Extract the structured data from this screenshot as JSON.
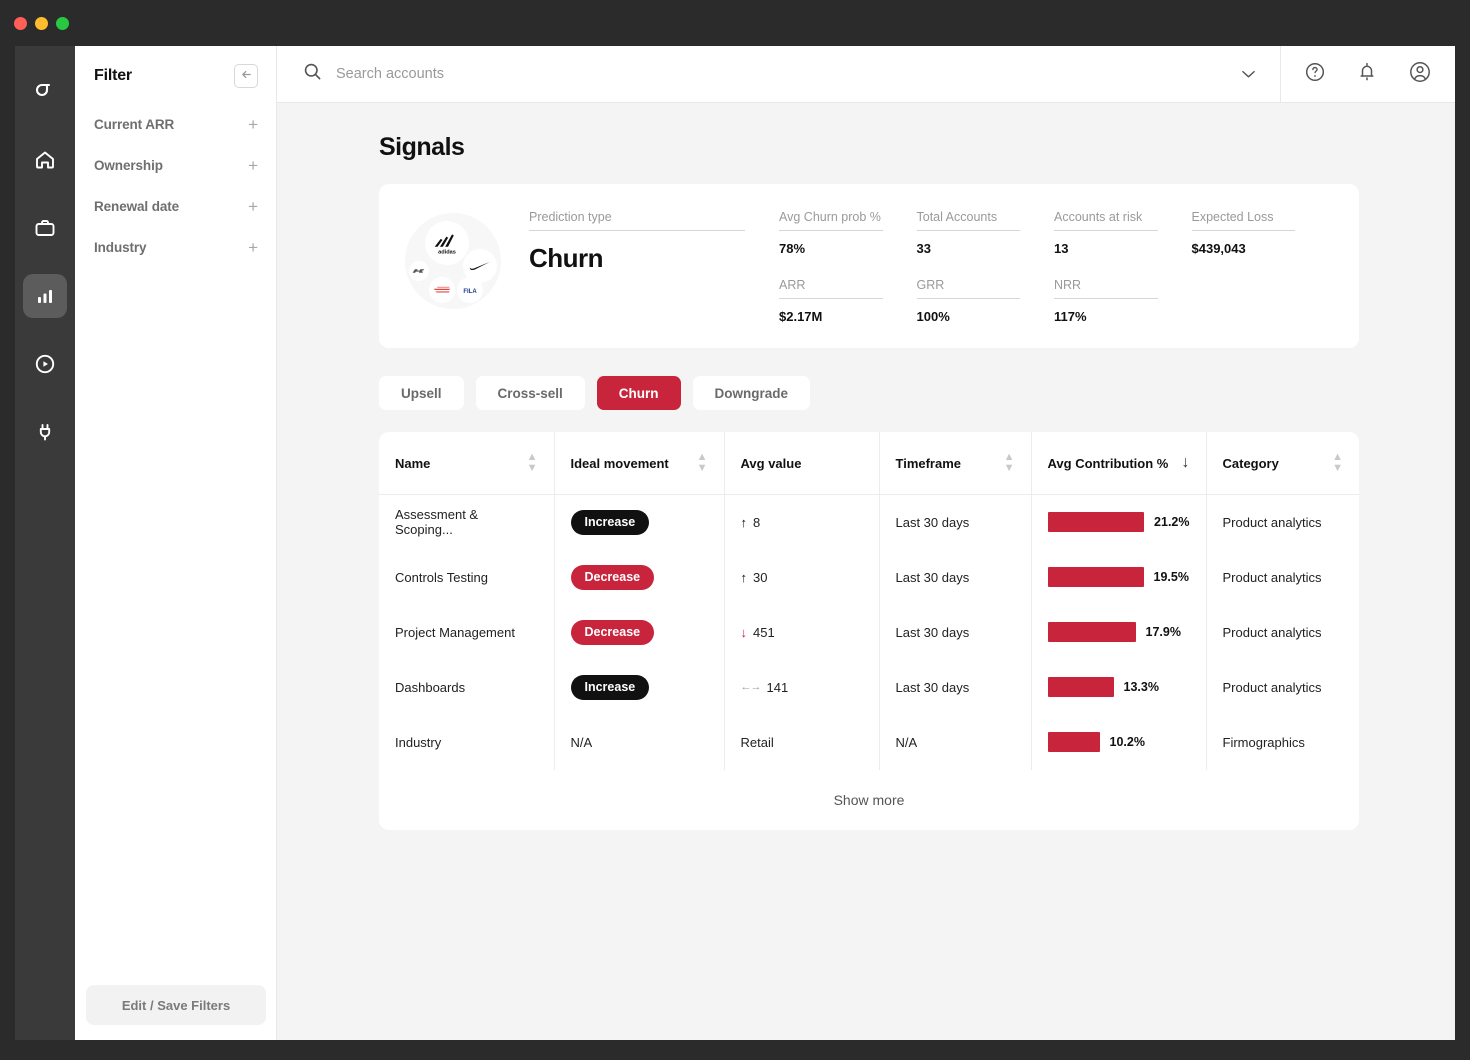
{
  "window": {
    "lights": [
      "close",
      "minimize",
      "maximize"
    ]
  },
  "rail": {
    "items": [
      {
        "name": "sigma-logo-icon",
        "label": "Sigma",
        "active": false
      },
      {
        "name": "home-icon",
        "label": "Home",
        "active": false
      },
      {
        "name": "briefcase-icon",
        "label": "Accounts",
        "active": false
      },
      {
        "name": "bar-chart-icon",
        "label": "Analytics",
        "active": true
      },
      {
        "name": "play-circle-icon",
        "label": "Playbooks",
        "active": false
      },
      {
        "name": "plug-icon",
        "label": "Integrations",
        "active": false
      }
    ]
  },
  "sidebar": {
    "title": "Filter",
    "collapse_icon": "arrow-left-icon",
    "items": [
      {
        "label": "Current ARR"
      },
      {
        "label": "Ownership"
      },
      {
        "label": "Renewal date"
      },
      {
        "label": "Industry"
      }
    ],
    "edit_save_label": "Edit / Save Filters"
  },
  "topbar": {
    "search_placeholder": "Search accounts",
    "search_value": "",
    "search_icon": "search-icon",
    "chevron_icon": "chevron-down-icon",
    "actions": [
      {
        "name": "help-icon",
        "label": "Help"
      },
      {
        "name": "bell-icon",
        "label": "Notifications"
      },
      {
        "name": "account-icon",
        "label": "Account"
      }
    ]
  },
  "page": {
    "title": "Signals"
  },
  "summary": {
    "logos": [
      "adidas",
      "nike",
      "new-balance",
      "brand-red",
      "FILA"
    ],
    "prediction": {
      "label": "Prediction type",
      "value": "Churn"
    },
    "metrics": [
      {
        "label": "Avg Churn prob %",
        "value": "78%"
      },
      {
        "label": "Total Accounts",
        "value": "33"
      },
      {
        "label": "Accounts at risk",
        "value": "13"
      },
      {
        "label": "Expected Loss",
        "value": "$439,043"
      },
      {
        "label": "ARR",
        "value": "$2.17M"
      },
      {
        "label": "GRR",
        "value": "100%"
      },
      {
        "label": "NRR",
        "value": "117%"
      }
    ]
  },
  "tabs": [
    {
      "label": "Upsell",
      "active": false
    },
    {
      "label": "Cross-sell",
      "active": false
    },
    {
      "label": "Churn",
      "active": true
    },
    {
      "label": "Downgrade",
      "active": false
    }
  ],
  "table": {
    "columns": [
      {
        "label": "Name",
        "sort": "none"
      },
      {
        "label": "Ideal movement",
        "sort": "none"
      },
      {
        "label": "Avg value",
        "sort": "hidden"
      },
      {
        "label": "Timeframe",
        "sort": "none"
      },
      {
        "label": "Avg Contribution %",
        "sort": "desc"
      },
      {
        "label": "Category",
        "sort": "none"
      }
    ],
    "rows": [
      {
        "name": "Assessment & Scoping...",
        "movement": "Increase",
        "movement_type": "increase",
        "value": "8",
        "value_trend": "up",
        "timeframe": "Last 30 days",
        "contribution": "21.2%",
        "contribution_pct": 21.2,
        "category": "Product analytics"
      },
      {
        "name": "Controls Testing",
        "movement": "Decrease",
        "movement_type": "decrease",
        "value": "30",
        "value_trend": "up",
        "timeframe": "Last 30 days",
        "contribution": "19.5%",
        "contribution_pct": 19.5,
        "category": "Product analytics"
      },
      {
        "name": "Project Management",
        "movement": "Decrease",
        "movement_type": "decrease",
        "value": "451",
        "value_trend": "down",
        "timeframe": "Last 30 days",
        "contribution": "17.9%",
        "contribution_pct": 17.9,
        "category": "Product analytics"
      },
      {
        "name": "Dashboards",
        "movement": "Increase",
        "movement_type": "increase",
        "value": "141",
        "value_trend": "flat",
        "timeframe": "Last 30 days",
        "contribution": "13.3%",
        "contribution_pct": 13.3,
        "category": "Product analytics"
      },
      {
        "name": "Industry",
        "movement": "N/A",
        "movement_type": "na",
        "value": "Retail",
        "value_trend": "none",
        "timeframe": "N/A",
        "contribution": "10.2%",
        "contribution_pct": 10.2,
        "category": "Firmographics"
      }
    ],
    "show_more_label": "Show more"
  },
  "colors": {
    "accent": "#c8243c",
    "dark": "#111111",
    "chrome": "#2b2b2b",
    "rail": "#3a3a3a",
    "canvas": "#f4f4f4"
  }
}
